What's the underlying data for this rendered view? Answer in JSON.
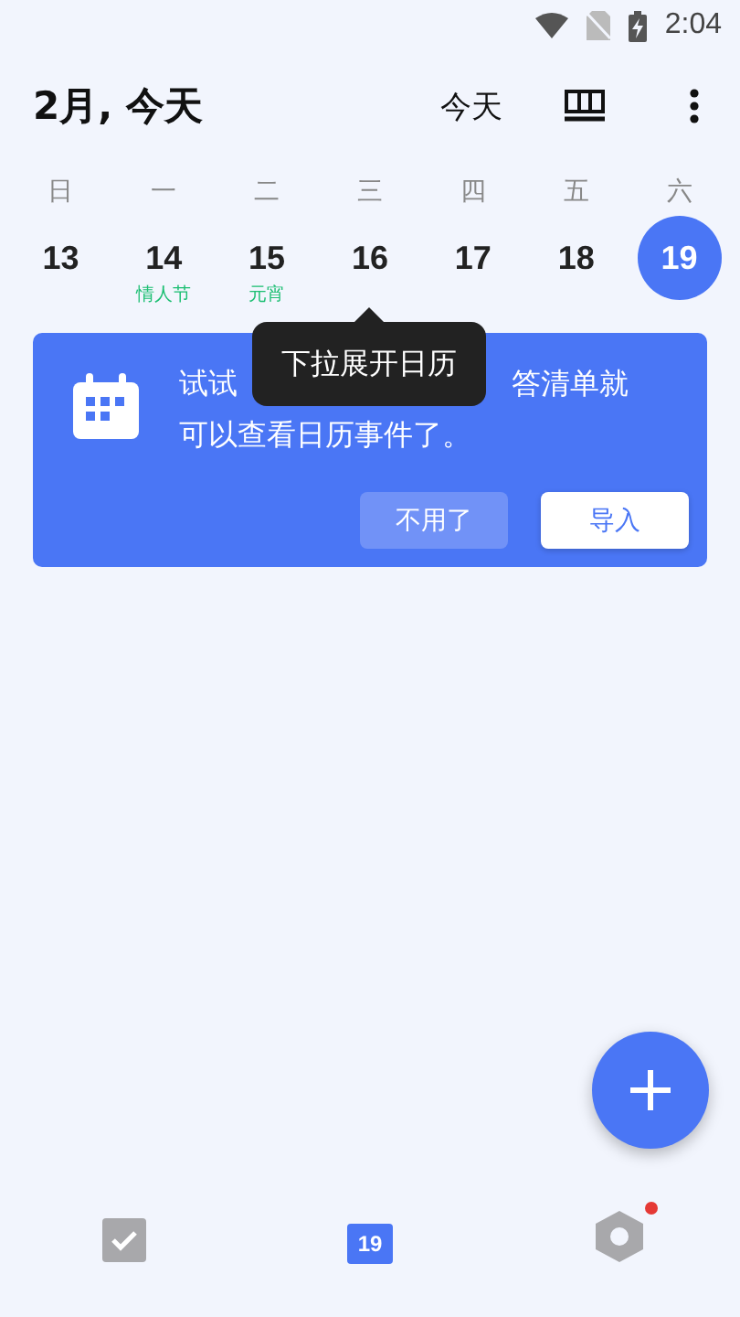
{
  "status_bar": {
    "time": "2:04"
  },
  "header": {
    "title": "2月, 今天",
    "today_button": "今天"
  },
  "weekdays": [
    "日",
    "一",
    "二",
    "三",
    "四",
    "五",
    "六"
  ],
  "days": [
    {
      "date": "13",
      "selected": false
    },
    {
      "date": "14",
      "note": "情人节",
      "selected": false
    },
    {
      "date": "15",
      "note": "元宵",
      "selected": false
    },
    {
      "date": "16",
      "selected": false
    },
    {
      "date": "17",
      "selected": false
    },
    {
      "date": "18",
      "selected": false
    },
    {
      "date": "19",
      "selected": true
    }
  ],
  "banner": {
    "line1_start": "试试",
    "line1_end": "答清单就",
    "line2": "可以查看日历事件了。",
    "dismiss_button": "不用了",
    "import_button": "导入"
  },
  "tooltip": {
    "text": "下拉展开日历"
  },
  "bottom_nav": [
    {
      "kind": "tasks",
      "selected": false
    },
    {
      "kind": "calendar",
      "label": "19",
      "selected": true
    },
    {
      "kind": "settings",
      "selected": false,
      "badge": true
    }
  ]
}
